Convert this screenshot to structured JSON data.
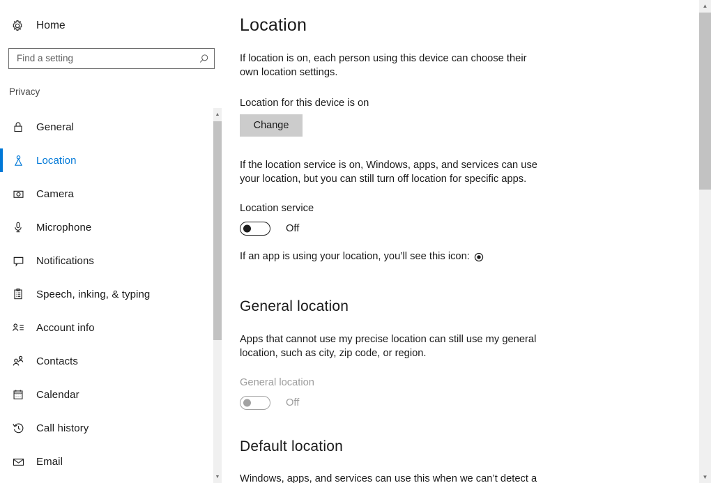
{
  "sidebar": {
    "home": {
      "label": "Home",
      "icon": "gear-icon"
    },
    "search": {
      "placeholder": "Find a setting",
      "value": "",
      "icon": "search-icon"
    },
    "section_label": "Privacy",
    "items": [
      {
        "label": "General",
        "icon": "lock-icon",
        "selected": false
      },
      {
        "label": "Location",
        "icon": "location-person-icon",
        "selected": true
      },
      {
        "label": "Camera",
        "icon": "camera-icon",
        "selected": false
      },
      {
        "label": "Microphone",
        "icon": "microphone-icon",
        "selected": false
      },
      {
        "label": "Notifications",
        "icon": "notification-bubble-icon",
        "selected": false
      },
      {
        "label": "Speech, inking, & typing",
        "icon": "clipboard-icon",
        "selected": false
      },
      {
        "label": "Account info",
        "icon": "account-info-icon",
        "selected": false
      },
      {
        "label": "Contacts",
        "icon": "contacts-icon",
        "selected": false
      },
      {
        "label": "Calendar",
        "icon": "calendar-icon",
        "selected": false
      },
      {
        "label": "Call history",
        "icon": "call-history-icon",
        "selected": false
      },
      {
        "label": "Email",
        "icon": "envelope-icon",
        "selected": false
      }
    ],
    "scrollbar": {
      "up_arrow": "▲",
      "down_arrow": "▼"
    }
  },
  "main": {
    "title": "Location",
    "intro": "If location is on, each person using this device can choose their own location settings.",
    "device_state": "Location for this device is on",
    "change_button": "Change",
    "service_description": "If the location service is on, Windows, apps, and services can use your location, but you can still turn off location for specific apps.",
    "location_service": {
      "label": "Location service",
      "state": "Off",
      "enabled": true
    },
    "icon_note": "If an app is using your location, you’ll see this icon:",
    "general_location": {
      "heading": "General location",
      "description": "Apps that cannot use my precise location can still use my general location, such as city, zip code, or region.",
      "label": "General location",
      "state": "Off",
      "enabled": false
    },
    "default_location": {
      "heading": "Default location",
      "description": "Windows, apps, and services can use this when we can’t detect a"
    }
  },
  "window_scrollbar": {
    "up_arrow": "▲",
    "down_arrow": "▼"
  },
  "colors": {
    "accent": "#0078d7",
    "text": "#1a1a1a",
    "disabled_text": "#9d9d9d",
    "button_bg": "#cccccc",
    "scrollbar_thumb": "#c2c2c2",
    "scrollbar_track": "#f0f0f0"
  }
}
